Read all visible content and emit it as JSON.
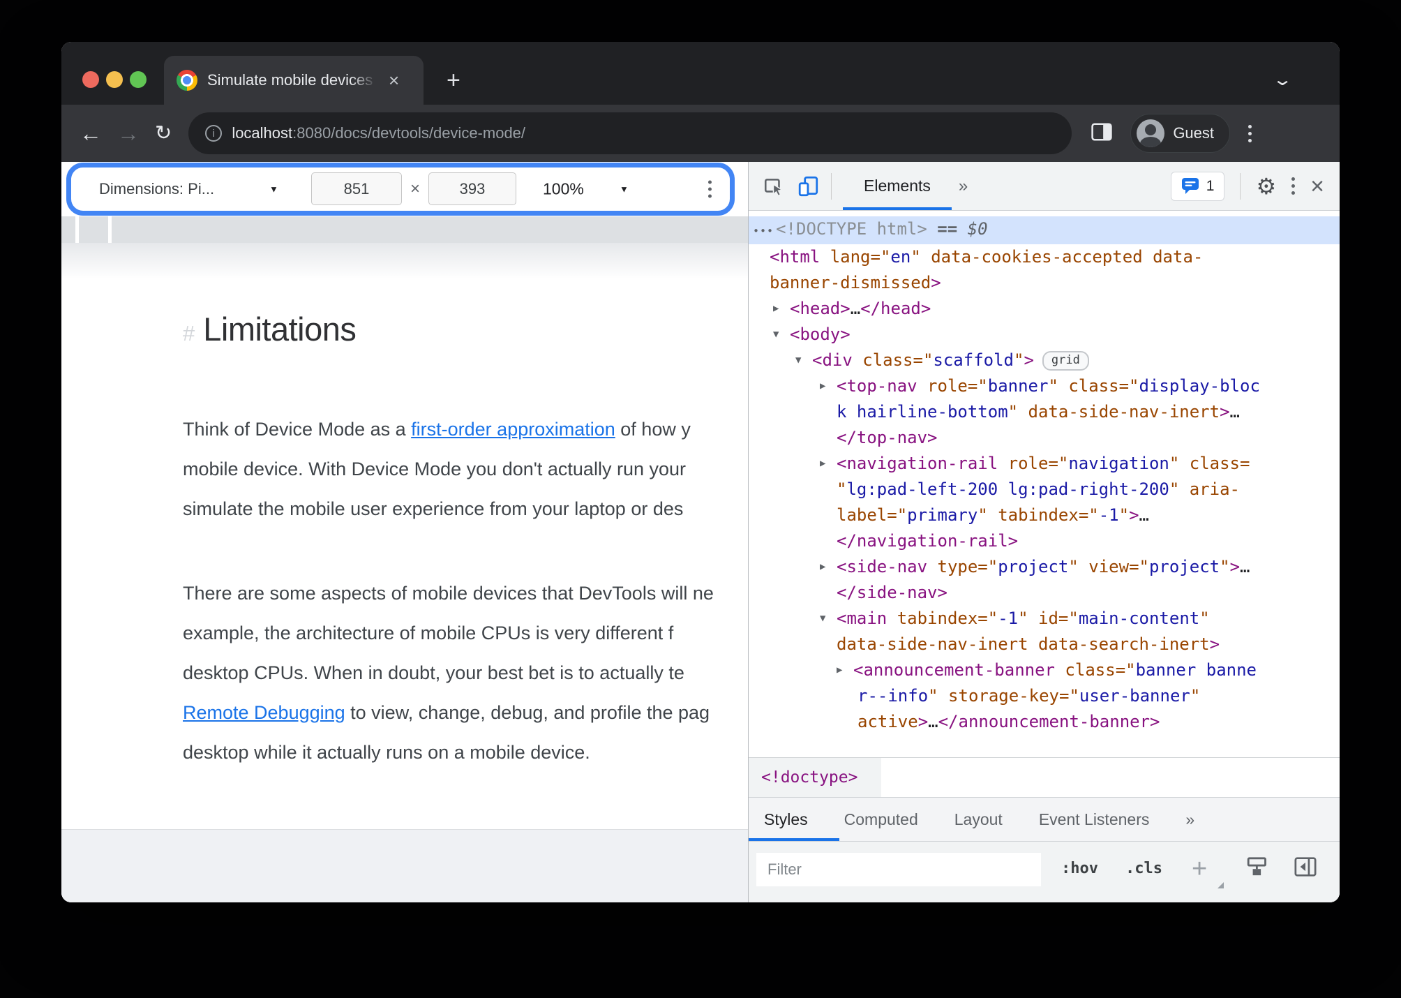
{
  "browser": {
    "tab_title": "Simulate mobile devices with D",
    "new_tab_plus": "+",
    "url_host": "localhost",
    "url_path": ":8080/docs/devtools/device-mode/",
    "guest_label": "Guest",
    "info_glyph": "i",
    "back_glyph": "←",
    "forward_glyph": "→",
    "reload_glyph": "↻",
    "chevron_glyph": "⌄",
    "close_tab_glyph": "×"
  },
  "device_toolbar": {
    "dimensions_label": "Dimensions: Pi...",
    "width_value": "851",
    "times": "×",
    "height_value": "393",
    "zoom_value": "100%",
    "caret": "▼",
    "highlight_color": "#4285f4"
  },
  "page": {
    "heading_hash": "#",
    "heading": "Limitations",
    "paragraphs": [
      {
        "lines": [
          [
            {
              "t": "Think of Device Mode as a "
            },
            {
              "t": "first-order approximation",
              "link": true
            },
            {
              "t": " of how y"
            }
          ],
          [
            {
              "t": "mobile device. With Device Mode you don't actually run your"
            }
          ],
          [
            {
              "t": "simulate the mobile user experience from your laptop or des"
            }
          ]
        ]
      },
      {
        "lines": [
          [
            {
              "t": "There are some aspects of mobile devices that DevTools will ne"
            }
          ],
          [
            {
              "t": "example, the architecture of mobile CPUs is very different f"
            }
          ],
          [
            {
              "t": "desktop CPUs. When in doubt, your best bet is to actually te"
            }
          ],
          [
            {
              "t": "Remote Debugging",
              "link": true
            },
            {
              "t": " to view, change, debug, and profile the pag"
            }
          ],
          [
            {
              "t": "desktop while it actually runs on a mobile device."
            }
          ]
        ]
      }
    ]
  },
  "devtools": {
    "panel_tab": "Elements",
    "overflow_glyph": "»",
    "issues_count": "1",
    "gear_glyph": "⚙",
    "close_glyph": "×",
    "breadcrumb": "<!doctype>",
    "tabs": [
      "Styles",
      "Computed",
      "Layout",
      "Event Listeners"
    ],
    "tabs_overflow": "»",
    "filter_placeholder": "Filter",
    "hov_label": ":hov",
    "cls_label": ".cls",
    "plus_label": "+",
    "code_lines": [
      {
        "ind": 6,
        "hl": true,
        "tokens": [
          [
            "•••",
            "dots"
          ],
          [
            "<!DOCTYPE html>",
            "gray"
          ],
          [
            " ",
            "plain"
          ],
          [
            "== ",
            "eq"
          ],
          [
            "$0",
            "dollar"
          ]
        ]
      },
      {
        "ind": 30,
        "tokens": [
          [
            "<html",
            "tag"
          ],
          [
            " lang",
            "attr"
          ],
          [
            "=\"",
            "attr"
          ],
          [
            "en",
            "val"
          ],
          [
            "\"",
            "attr"
          ],
          [
            " data-cookies-accepted data-",
            "attr"
          ]
        ]
      },
      {
        "ind": 30,
        "tokens": [
          [
            "banner-dismissed",
            "attr"
          ],
          [
            ">",
            "tag"
          ]
        ]
      },
      {
        "ind": 59,
        "arrow": "r",
        "tokens": [
          [
            "<head>",
            "tag"
          ],
          [
            "…",
            "plain"
          ],
          [
            "</head>",
            "tag"
          ]
        ]
      },
      {
        "ind": 59,
        "arrow": "d",
        "tokens": [
          [
            "<body>",
            "tag"
          ]
        ]
      },
      {
        "ind": 91,
        "arrow": "d",
        "tokens": [
          [
            "<div",
            "tag"
          ],
          [
            " class",
            "attr"
          ],
          [
            "=\"",
            "attr"
          ],
          [
            "scaffold",
            "val"
          ],
          [
            "\"",
            "attr"
          ],
          [
            ">",
            "tag"
          ],
          [
            "grid",
            "badge"
          ]
        ]
      },
      {
        "ind": 126,
        "arrow": "r",
        "tokens": [
          [
            "<top-nav",
            "tag"
          ],
          [
            " role",
            "attr"
          ],
          [
            "=\"",
            "attr"
          ],
          [
            "banner",
            "val"
          ],
          [
            "\"",
            "attr"
          ],
          [
            " class",
            "attr"
          ],
          [
            "=\"",
            "attr"
          ],
          [
            "display-bloc",
            "val"
          ]
        ]
      },
      {
        "ind": 126,
        "tokens": [
          [
            "k hairline-bottom",
            "val"
          ],
          [
            "\"",
            "attr"
          ],
          [
            " data-side-nav-inert",
            "attr"
          ],
          [
            ">",
            "tag"
          ],
          [
            "…",
            "plain"
          ]
        ]
      },
      {
        "ind": 126,
        "tokens": [
          [
            "</top-nav>",
            "tag"
          ]
        ]
      },
      {
        "ind": 126,
        "arrow": "r",
        "tokens": [
          [
            "<navigation-rail",
            "tag"
          ],
          [
            " role",
            "attr"
          ],
          [
            "=\"",
            "attr"
          ],
          [
            "navigation",
            "val"
          ],
          [
            "\"",
            "attr"
          ],
          [
            " class",
            "attr"
          ],
          [
            "=",
            "attr"
          ]
        ]
      },
      {
        "ind": 126,
        "tokens": [
          [
            "\"",
            "attr"
          ],
          [
            "lg:pad-left-200 lg:pad-right-200",
            "val"
          ],
          [
            "\"",
            "attr"
          ],
          [
            " aria-",
            "attr"
          ]
        ]
      },
      {
        "ind": 126,
        "tokens": [
          [
            "label",
            "attr"
          ],
          [
            "=\"",
            "attr"
          ],
          [
            "primary",
            "val"
          ],
          [
            "\"",
            "attr"
          ],
          [
            " tabindex",
            "attr"
          ],
          [
            "=\"",
            "attr"
          ],
          [
            "-1",
            "val"
          ],
          [
            "\"",
            "attr"
          ],
          [
            ">",
            "tag"
          ],
          [
            "…",
            "plain"
          ]
        ]
      },
      {
        "ind": 126,
        "tokens": [
          [
            "</navigation-rail>",
            "tag"
          ]
        ]
      },
      {
        "ind": 126,
        "arrow": "r",
        "tokens": [
          [
            "<side-nav",
            "tag"
          ],
          [
            " type",
            "attr"
          ],
          [
            "=\"",
            "attr"
          ],
          [
            "project",
            "val"
          ],
          [
            "\"",
            "attr"
          ],
          [
            " view",
            "attr"
          ],
          [
            "=\"",
            "attr"
          ],
          [
            "project",
            "val"
          ],
          [
            "\"",
            "attr"
          ],
          [
            ">",
            "tag"
          ],
          [
            "…",
            "plain"
          ]
        ]
      },
      {
        "ind": 126,
        "tokens": [
          [
            "</side-nav>",
            "tag"
          ]
        ]
      },
      {
        "ind": 126,
        "arrow": "d",
        "tokens": [
          [
            "<main",
            "tag"
          ],
          [
            " tabindex",
            "attr"
          ],
          [
            "=\"",
            "attr"
          ],
          [
            "-1",
            "val"
          ],
          [
            "\"",
            "attr"
          ],
          [
            " id",
            "attr"
          ],
          [
            "=\"",
            "attr"
          ],
          [
            "main-content",
            "val"
          ],
          [
            "\"",
            "attr"
          ]
        ]
      },
      {
        "ind": 126,
        "tokens": [
          [
            "data-side-nav-inert data-search-inert",
            "attr"
          ],
          [
            ">",
            "tag"
          ]
        ]
      },
      {
        "ind": 150,
        "arrow": "r",
        "tokens": [
          [
            "<announcement-banner",
            "tag"
          ],
          [
            " class",
            "attr"
          ],
          [
            "=\"",
            "attr"
          ],
          [
            "banner banne",
            "val"
          ]
        ]
      },
      {
        "ind": 156,
        "tokens": [
          [
            "r--info",
            "val"
          ],
          [
            "\"",
            "attr"
          ],
          [
            " storage-key",
            "attr"
          ],
          [
            "=\"",
            "attr"
          ],
          [
            "user-banner",
            "val"
          ],
          [
            "\"",
            "attr"
          ]
        ]
      },
      {
        "ind": 156,
        "tokens": [
          [
            "active",
            "attr"
          ],
          [
            ">",
            "tag"
          ],
          [
            "…",
            "plain"
          ],
          [
            "</announcement-banner>",
            "tag"
          ]
        ]
      }
    ]
  }
}
